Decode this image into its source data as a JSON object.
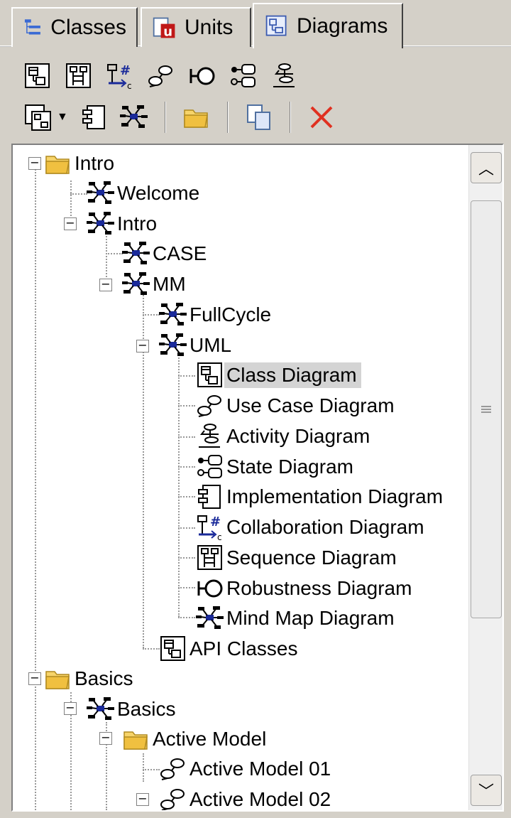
{
  "tabs": [
    {
      "label": "Classes",
      "icon": "classes-tree-icon",
      "active": false
    },
    {
      "label": "Units",
      "icon": "units-icon",
      "active": false
    },
    {
      "label": "Diagrams",
      "icon": "diagrams-icon",
      "active": true
    }
  ],
  "toolbar": {
    "row1": [
      "new-class-diagram-icon",
      "new-sequence-diagram-icon",
      "new-collaboration-diagram-icon",
      "new-use-case-diagram-icon",
      "new-robustness-diagram-icon",
      "new-state-diagram-icon",
      "new-activity-diagram-icon"
    ],
    "row2": [
      "new-diagram-dropdown-icon",
      "new-implementation-diagram-icon",
      "new-mind-map-diagram-icon",
      "new-folder-icon",
      "copy-icon",
      "delete-icon"
    ]
  },
  "tree": [
    {
      "label": "Intro",
      "icon": "folder-icon",
      "expanded": true
    },
    {
      "label": "Welcome",
      "icon": "mind-map-icon"
    },
    {
      "label": "Intro",
      "icon": "mind-map-icon",
      "expanded": true
    },
    {
      "label": "CASE",
      "icon": "mind-map-icon"
    },
    {
      "label": "MM",
      "icon": "mind-map-icon",
      "expanded": true
    },
    {
      "label": "FullCycle",
      "icon": "mind-map-icon"
    },
    {
      "label": "UML",
      "icon": "mind-map-icon",
      "expanded": true
    },
    {
      "label": "Class Diagram",
      "icon": "class-diagram-icon",
      "selected": true
    },
    {
      "label": "Use Case Diagram",
      "icon": "use-case-diagram-icon"
    },
    {
      "label": "Activity Diagram",
      "icon": "activity-diagram-icon"
    },
    {
      "label": "State Diagram",
      "icon": "state-diagram-icon"
    },
    {
      "label": "Implementation Diagram",
      "icon": "implementation-diagram-icon"
    },
    {
      "label": "Collaboration Diagram",
      "icon": "collaboration-diagram-icon"
    },
    {
      "label": "Sequence Diagram",
      "icon": "sequence-diagram-icon"
    },
    {
      "label": "Robustness Diagram",
      "icon": "robustness-diagram-icon"
    },
    {
      "label": "Mind Map Diagram",
      "icon": "mind-map-icon"
    },
    {
      "label": "API Classes",
      "icon": "class-diagram-icon"
    },
    {
      "label": "Basics",
      "icon": "folder-icon",
      "expanded": true
    },
    {
      "label": "Basics",
      "icon": "mind-map-icon",
      "expanded": true
    },
    {
      "label": "Active Model",
      "icon": "folder-icon",
      "expanded": true
    },
    {
      "label": "Active Model 01",
      "icon": "use-case-diagram-icon"
    },
    {
      "label": "Active Model 02",
      "icon": "use-case-diagram-icon",
      "expanded": true
    }
  ],
  "colors": {
    "folder": "#f0c040",
    "delete": "#e03020",
    "selection": "#d4d4d4",
    "collab": "#1a2a9a"
  }
}
